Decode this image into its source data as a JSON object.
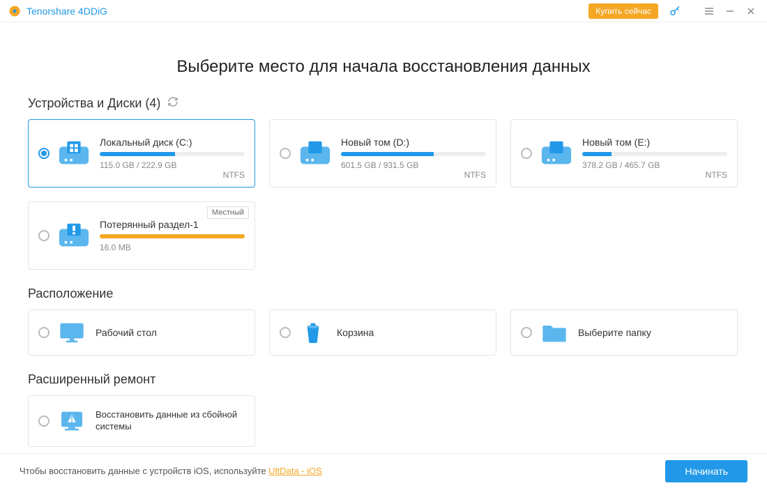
{
  "app": {
    "name": "Tenorshare 4DDiG"
  },
  "titlebar": {
    "buy": "Купить сейчас"
  },
  "heading": "Выберите место для начала восстановления данных",
  "sections": {
    "drives_label": "Устройства и Диски",
    "drives_count": "(4)",
    "locations_label": "Расположение",
    "advanced_label": "Расширенный ремонт"
  },
  "drives": [
    {
      "name": "Локальный диск (C:)",
      "size": "115.0 GB / 222.9 GB",
      "fs": "NTFS",
      "fill": 52,
      "color": "#2199e8",
      "selected": true,
      "icon": "win"
    },
    {
      "name": "Новый том (D:)",
      "size": "601.5 GB / 931.5 GB",
      "fs": "NTFS",
      "fill": 64,
      "color": "#2199e8",
      "selected": false,
      "icon": "drive"
    },
    {
      "name": "Новый том (E:)",
      "size": "378.2 GB / 465.7 GB",
      "fs": "NTFS",
      "fill": 20,
      "color": "#2199e8",
      "selected": false,
      "icon": "drive"
    },
    {
      "name": "Потерянный раздел-1",
      "size": "16.0 MB",
      "fs": "",
      "fill": 100,
      "color": "#f5a623",
      "selected": false,
      "icon": "lost",
      "tag": "Местный"
    }
  ],
  "locations": [
    {
      "label": "Рабочий стол",
      "icon": "desktop"
    },
    {
      "label": "Корзина",
      "icon": "trash"
    },
    {
      "label": "Выберите папку",
      "icon": "folder"
    }
  ],
  "advanced": {
    "label": "Восстановить данные из сбойной системы"
  },
  "footer": {
    "text": "Чтобы восстановить данные с устройств iOS, используйте ",
    "link": "UltData - iOS",
    "start": "Начинать"
  }
}
